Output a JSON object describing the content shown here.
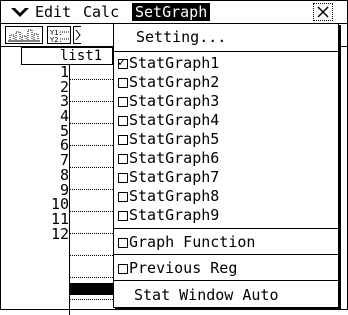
{
  "menubar": {
    "edit_label": "Edit",
    "calc_label": "Calc",
    "setgraph_label": "SetGraph"
  },
  "toolbar": {
    "lists_icon_text": "Y1:\nY2:"
  },
  "sheet": {
    "header": "list1",
    "rows": [
      "1",
      "2",
      "3",
      "4",
      "5",
      "6",
      "7",
      "8",
      "9",
      "10",
      "11",
      "12"
    ]
  },
  "dropdown": {
    "setting_label": "Setting...",
    "stat_graphs": [
      {
        "label": "StatGraph1",
        "checked": true
      },
      {
        "label": "StatGraph2",
        "checked": false
      },
      {
        "label": "StatGraph3",
        "checked": false
      },
      {
        "label": "StatGraph4",
        "checked": false
      },
      {
        "label": "StatGraph5",
        "checked": false
      },
      {
        "label": "StatGraph6",
        "checked": false
      },
      {
        "label": "StatGraph7",
        "checked": false
      },
      {
        "label": "StatGraph8",
        "checked": false
      },
      {
        "label": "StatGraph9",
        "checked": false
      }
    ],
    "graph_function_label": "Graph Function",
    "previous_reg_label": "Previous Reg",
    "stat_window_auto_label": "Stat Window Auto"
  }
}
